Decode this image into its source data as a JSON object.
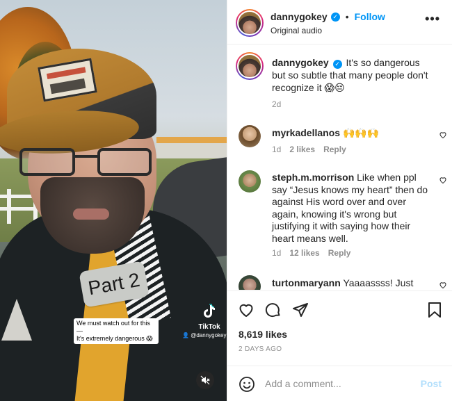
{
  "video": {
    "overlay_text": "Part 2",
    "caption_line1": "We must watch out for this—",
    "caption_line2": "It's extremely dangerous 😱",
    "watermark_name": "TikTok",
    "watermark_handle": "@dannygokey"
  },
  "header": {
    "username": "dannygokey",
    "separator": "•",
    "follow_label": "Follow",
    "subtitle": "Original audio",
    "more_label": "•••"
  },
  "caption": {
    "username": "dannygokey",
    "text": "It's so dangerous but so subtle that many people don't recognize it 😱😔",
    "time": "2d"
  },
  "comments": [
    {
      "username": "myrkadellanos",
      "text": "🙌🙌🙌",
      "time": "1d",
      "likes": "2 likes",
      "reply": "Reply"
    },
    {
      "username": "steph.m.morrison",
      "text": "Like when ppl say “Jesus knows my heart” then do against His word over and over again, knowing it's wrong but justifying it with saying how their heart means well.",
      "time": "1d",
      "likes": "12 likes",
      "reply": "Reply"
    },
    {
      "username": "turtonmaryann",
      "text": "Yaaaassss! Just"
    }
  ],
  "actions": {
    "likes": "8,619 likes",
    "date": "2 DAYS AGO"
  },
  "composer": {
    "placeholder": "Add a comment...",
    "post_label": "Post"
  },
  "colors": {
    "accent": "#0095f6",
    "post_disabled": "#b2dffc",
    "muted_text": "#8e8e8e"
  }
}
